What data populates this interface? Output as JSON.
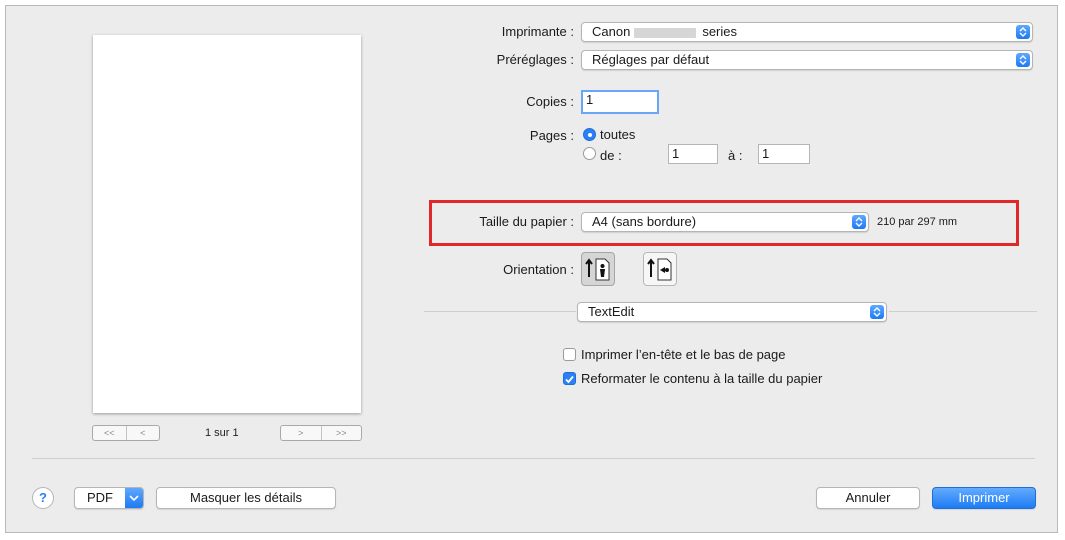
{
  "printer": {
    "label": "Imprimante :",
    "value_prefix": "Canon",
    "value_suffix": "series"
  },
  "presets": {
    "label": "Préréglages :",
    "value": "Réglages par défaut"
  },
  "copies": {
    "label": "Copies :",
    "value": "1"
  },
  "pages": {
    "label": "Pages :",
    "all_label": "toutes",
    "range_label": "de :",
    "from": "1",
    "to_label": "à :",
    "to": "1",
    "selected": "toutes"
  },
  "paper_size": {
    "label": "Taille du papier :",
    "value": "A4 (sans bordure)",
    "dimensions": "210 par 297 mm"
  },
  "orientation": {
    "label": "Orientation :",
    "options": [
      "portrait",
      "landscape"
    ],
    "selected": "portrait"
  },
  "app_section": {
    "value": "TextEdit"
  },
  "options": [
    {
      "label": "Imprimer l’en-tête et le bas de page",
      "checked": false
    },
    {
      "label": "Reformater le contenu à la taille du papier",
      "checked": true
    }
  ],
  "preview": {
    "page_indicator": "1 sur 1",
    "nav_first": "<<",
    "nav_prev": "<",
    "nav_next": ">",
    "nav_last": ">>"
  },
  "footer": {
    "help": "?",
    "pdf": "PDF",
    "hide_details": "Masquer les détails",
    "cancel": "Annuler",
    "print": "Imprimer"
  },
  "colors": {
    "accent": "#2b80f5",
    "highlight": "#e0282a",
    "dialog_bg": "#ececec"
  },
  "icons": {
    "popup": "up-down-chevron-icon",
    "help": "help-icon",
    "pdf_menu": "chevron-down-icon"
  }
}
